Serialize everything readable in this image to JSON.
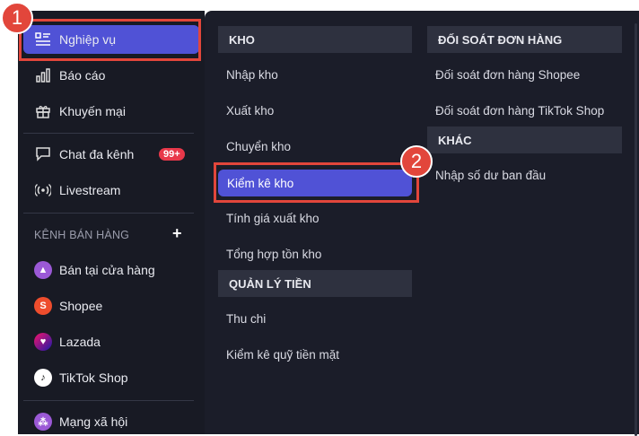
{
  "sidebar": {
    "items": [
      {
        "label": "Nghiệp vụ",
        "icon": "list-icon"
      },
      {
        "label": "Báo cáo",
        "icon": "bar-chart-icon"
      },
      {
        "label": "Khuyến mại",
        "icon": "gift-icon"
      },
      {
        "label": "Chat đa kênh",
        "icon": "chat-icon"
      },
      {
        "label": "Livestream",
        "icon": "broadcast-icon"
      }
    ],
    "chat_badge": "99+",
    "channels_title": "KÊNH BÁN HÀNG",
    "channels_add": "+",
    "channels": [
      {
        "label": "Bán tại cửa hàng",
        "icon": "store-icon",
        "color": "#9b59d6"
      },
      {
        "label": "Shopee",
        "icon": "shopee-icon",
        "color": "#ee4d2d"
      },
      {
        "label": "Lazada",
        "icon": "lazada-icon",
        "color": "#1a1aa8"
      },
      {
        "label": "TikTok Shop",
        "icon": "tiktok-icon",
        "color": "#ffffff"
      }
    ],
    "social": {
      "label": "Mạng xã hội",
      "icon": "social-icon",
      "color": "#9b59d6"
    }
  },
  "menu": {
    "kho": {
      "title": "KHO",
      "items": [
        "Nhập kho",
        "Xuất kho",
        "Chuyển kho",
        "Kiểm kê kho",
        "Tính giá xuất kho",
        "Tổng hợp tồn kho"
      ]
    },
    "tien": {
      "title": "QUẢN LÝ TIỀN",
      "items": [
        "Thu chi",
        "Kiểm kê quỹ tiền mặt"
      ]
    },
    "doisoat": {
      "title": "ĐỐI SOÁT ĐƠN HÀNG",
      "items": [
        "Đối soát đơn hàng Shopee",
        "Đối soát đơn hàng TikTok Shop"
      ]
    },
    "khac": {
      "title": "KHÁC",
      "items": [
        "Nhập số dư ban đầu"
      ]
    }
  },
  "steps": [
    "1",
    "2"
  ],
  "colors": {
    "accent": "#5052d6",
    "callout": "#e2463b",
    "sidebar_bg": "#181a24"
  }
}
